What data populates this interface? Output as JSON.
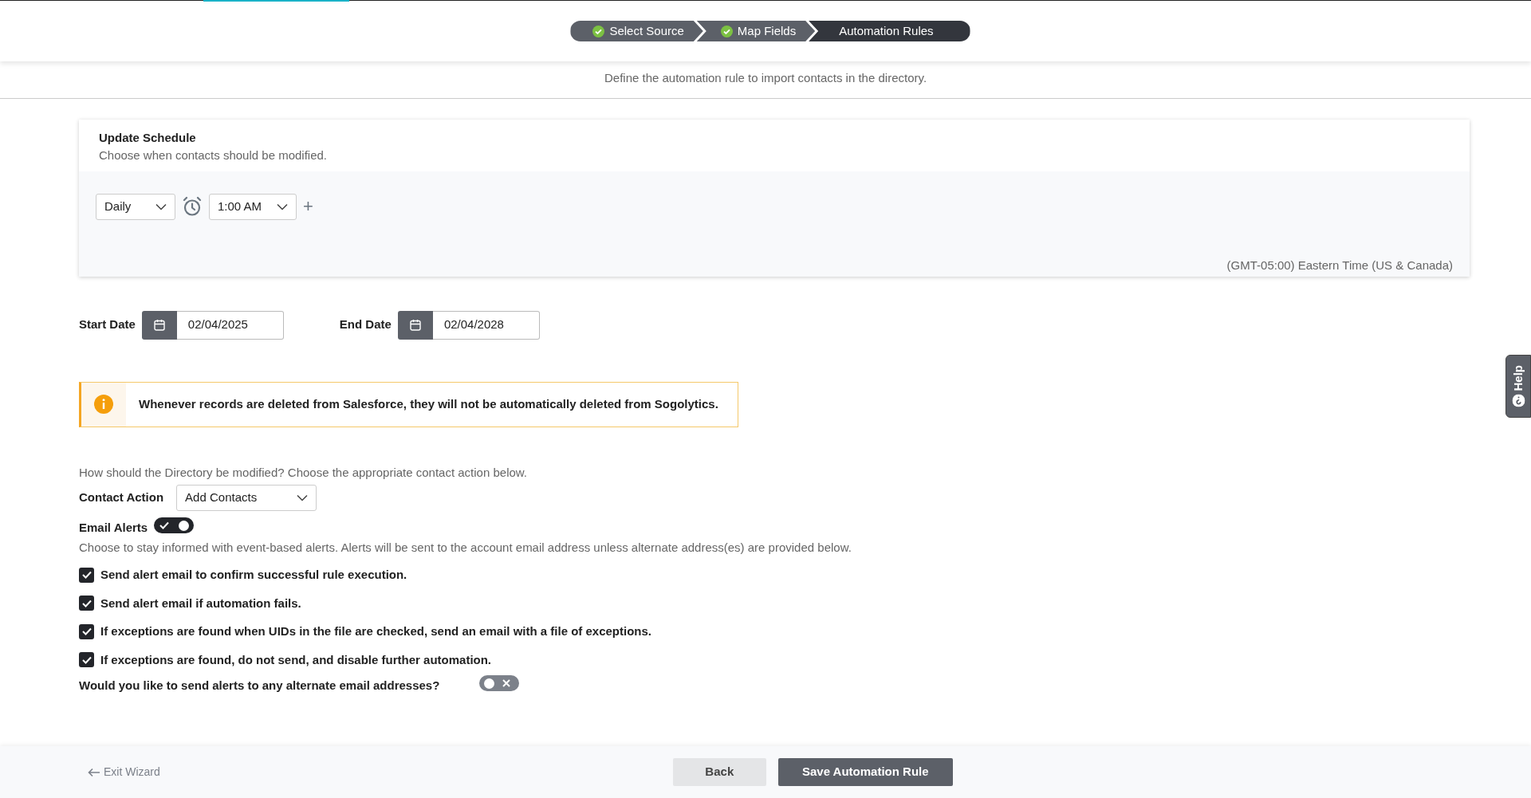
{
  "steps": [
    {
      "label": "Select Source",
      "done": true,
      "selected": false
    },
    {
      "label": "Map Fields",
      "done": true,
      "selected": false
    },
    {
      "label": "Automation Rules",
      "done": false,
      "selected": true
    }
  ],
  "subtitle": "Define the automation rule to import contacts in the directory.",
  "schedule": {
    "title": "Update Schedule",
    "description": "Choose when contacts should be modified.",
    "frequency": "Daily",
    "time": "1:00 AM",
    "add": "+",
    "timezone": "(GMT-05:00) Eastern Time (US & Canada)"
  },
  "dates": [
    {
      "label": "Start Date",
      "value": "02/04/2025"
    },
    {
      "label": "End Date",
      "value": "02/04/2028"
    }
  ],
  "notice": "Whenever records are deleted from Salesforce, they will not be automatically deleted from Sogolytics.",
  "question": "How should the Directory be modified? Choose the appropriate contact action below.",
  "contact_action": {
    "label": "Contact Action",
    "value": "Add Contacts"
  },
  "email_alerts": {
    "label": "Email Alerts",
    "on": true,
    "description": "Choose to stay informed with event-based alerts. Alerts will be sent to the account email address unless alternate address(es) are provided below."
  },
  "options": [
    {
      "label": "Send alert email to confirm successful rule execution.",
      "checked": true
    },
    {
      "label": "Send alert email if automation fails.",
      "checked": true
    },
    {
      "label": "If exceptions are found when UIDs in the file are checked, send an email with a file of exceptions.",
      "checked": true
    },
    {
      "label": "If exceptions are found, do not send, and disable further automation.",
      "checked": true
    }
  ],
  "alternate": {
    "label": "Would you like to send alerts to any alternate email addresses?",
    "on": false
  },
  "help": "Help",
  "footer": {
    "exit": "Exit Wizard",
    "back": "Back",
    "save": "Save Automation Rule"
  }
}
